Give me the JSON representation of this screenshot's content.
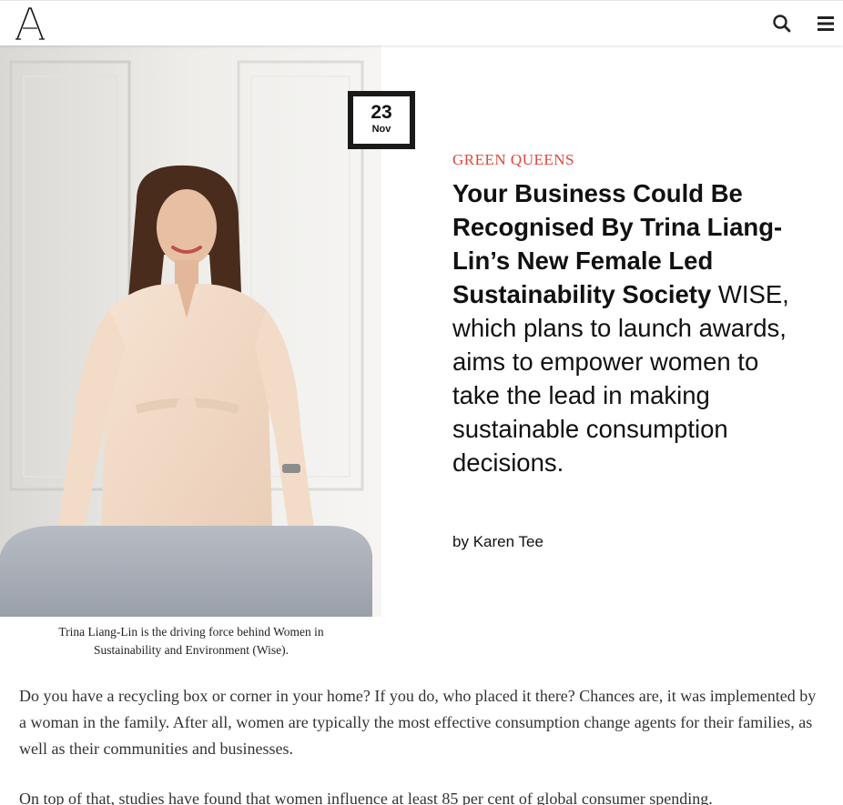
{
  "header": {
    "logo_icon": "letter-a-logo",
    "search_icon": "search-icon",
    "menu_icon": "hamburger-menu-icon"
  },
  "date": {
    "day": "23",
    "month": "Nov"
  },
  "article": {
    "category": "GREEN QUEENS",
    "title": "Your Business Could Be Recognised By Trina Liang-Lin’s New Female Led Sustainability Society",
    "dek": "WISE, which plans to launch awards, aims to empower women to take the lead in making sustainable consumption decisions.",
    "byline_prefix": "by",
    "author": "Karen Tee"
  },
  "caption": "Trina Liang-Lin is the driving force behind Women in Sustainability and Environment (Wise).",
  "body": [
    "Do you have a recycling box or corner in your home? If you do, who placed it there? Chances are, it was implemented by a woman in the family. After all, women are typically the most effective consumption change agents for their families, as well as their communities and businesses.",
    "On top of that, studies have found that women influence at least 85 per cent of global consumer spending."
  ],
  "colors": {
    "accent": "#e0463a",
    "badge": "#1a1a1a"
  }
}
